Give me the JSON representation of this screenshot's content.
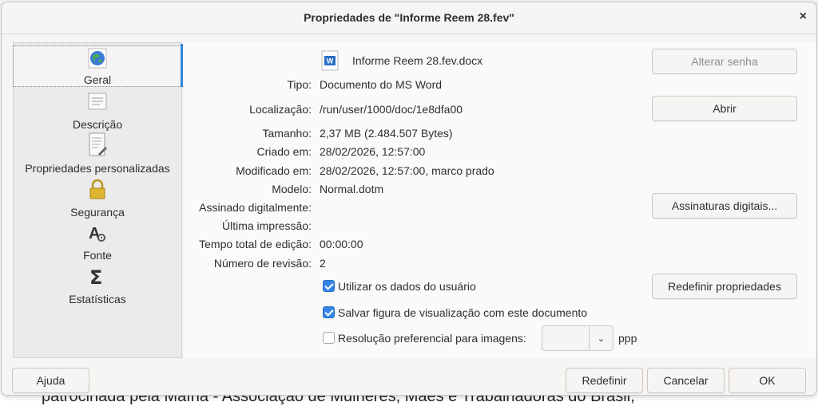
{
  "background_text": "patrocinada pela Mafna - Associação de Mulheres, Mães e Trabalhadoras do Brasil,",
  "dialog": {
    "title": "Propriedades de \"Informe Reem 28.fev\"",
    "close_glyph": "×"
  },
  "sidebar": {
    "items": [
      {
        "label": "Geral",
        "icon": "globe-icon"
      },
      {
        "label": "Descrição",
        "icon": "document-lines-icon"
      },
      {
        "label": "Propriedades personalizadas",
        "icon": "document-edit-icon"
      },
      {
        "label": "Segurança",
        "icon": "lock-icon"
      },
      {
        "label": "Fonte",
        "icon": "font-gear-icon"
      },
      {
        "label": "Estatísticas",
        "icon": "sigma-icon"
      }
    ]
  },
  "general": {
    "file_icon_letter": "W",
    "filename": "Informe Reem 28.fev.docx",
    "rows": [
      {
        "label": "Tipo:",
        "value": "Documento do MS Word"
      },
      {
        "label": "Localização:",
        "value": "/run/user/1000/doc/1e8dfa00"
      },
      {
        "label": "Tamanho:",
        "value": "2,37 MB (2.484.507 Bytes)"
      },
      {
        "label": "Criado em:",
        "value": "28/02/2026, 12:57:00"
      },
      {
        "label": "Modificado em:",
        "value": "28/02/2026, 12:57:00, marco prado"
      },
      {
        "label": "Modelo:",
        "value": "Normal.dotm"
      },
      {
        "label": "Assinado digitalmente:",
        "value": ""
      },
      {
        "label": "Última impressão:",
        "value": ""
      },
      {
        "label": "Tempo total de edição:",
        "value": "00:00:00"
      },
      {
        "label": "Número de revisão:",
        "value": "2"
      }
    ],
    "buttons": {
      "change_password": "Alterar senha",
      "open": "Abrir",
      "digital_signatures": "Assinaturas digitais...",
      "reset_properties": "Redefinir propriedades"
    },
    "checkboxes": {
      "use_user_data": {
        "label": "Utilizar os dados do usuário",
        "checked": true
      },
      "save_preview": {
        "label": "Salvar figura de visualização com este documento",
        "checked": true
      },
      "preferred_resolution": {
        "label": "Resolução preferencial para imagens:",
        "checked": false
      }
    },
    "resolution_value": "",
    "resolution_unit": "ppp"
  },
  "footer": {
    "help": "Ajuda",
    "reset": "Redefinir",
    "cancel": "Cancelar",
    "ok": "OK"
  }
}
